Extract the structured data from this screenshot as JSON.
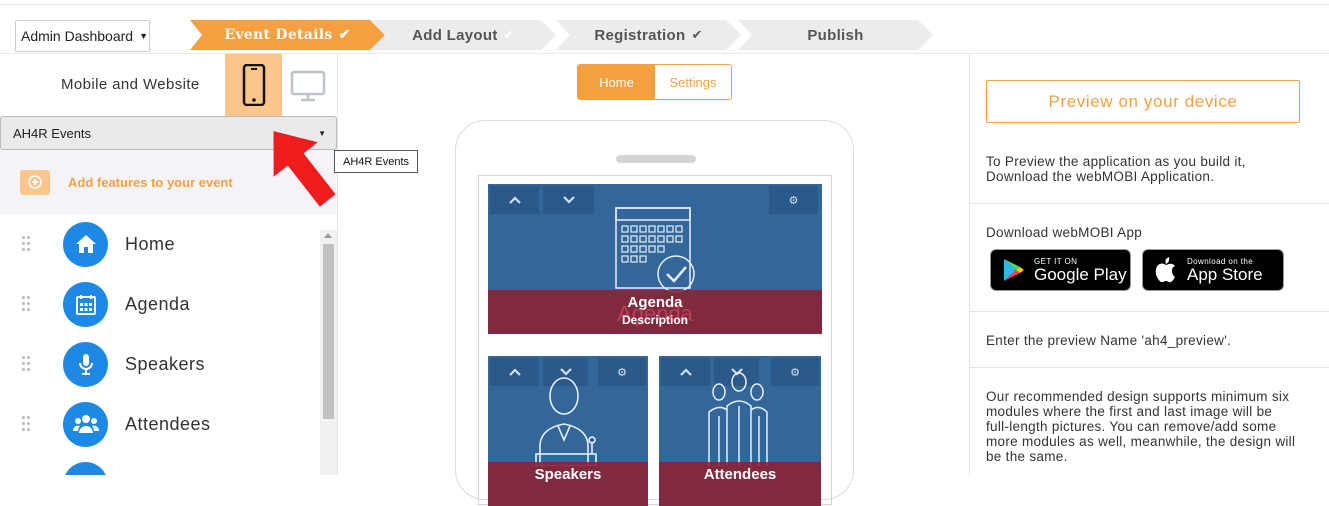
{
  "header": {
    "admin_dropdown": "Admin Dashboard",
    "steps": [
      {
        "label": "Event Details",
        "state": "active",
        "checked": true
      },
      {
        "label": "Add Layout",
        "state": "inactive",
        "checked": true
      },
      {
        "label": "Registration",
        "state": "inactive",
        "checked": true
      },
      {
        "label": "Publish",
        "state": "inactive",
        "checked": false
      }
    ]
  },
  "left": {
    "platform_label": "Mobile and Website",
    "event_select": "AH4R Events",
    "tooltip": "AH4R Events",
    "add_features": "Add features to your event",
    "modules": [
      {
        "label": "Home",
        "icon": "home-icon"
      },
      {
        "label": "Agenda",
        "icon": "calendar-icon"
      },
      {
        "label": "Speakers",
        "icon": "microphone-icon"
      },
      {
        "label": "Attendees",
        "icon": "users-icon"
      }
    ]
  },
  "center": {
    "tabs": [
      "Home",
      "Settings"
    ],
    "tiles": [
      {
        "title": "Agenda",
        "subtitle": "Description",
        "ghost": "Agenda"
      },
      {
        "title": "Speakers"
      },
      {
        "title": "Attendees"
      }
    ]
  },
  "right": {
    "preview_button": "Preview on your device",
    "preview_help_1": "To Preview the application as you build it,",
    "preview_help_2": "Download the webMOBI Application.",
    "download_label": "Download webMOBI App",
    "google_play": {
      "small": "GET IT ON",
      "big": "Google Play"
    },
    "app_store": {
      "small": "Download on the",
      "big": "App Store"
    },
    "preview_name": "Enter the preview Name 'ah4_preview'.",
    "design_note": [
      "Our recommended design supports minimum six",
      "modules where the first and last image will be",
      "full-length pictures. You can remove/add some",
      "more modules as well, meanwhile, the design will",
      "be the same."
    ]
  },
  "colors": {
    "accent": "#f5a040",
    "accent_light": "#fcc58b",
    "tile_blue": "#336699",
    "icon_blue": "#1e88e5",
    "band_red": "#8c2232"
  }
}
